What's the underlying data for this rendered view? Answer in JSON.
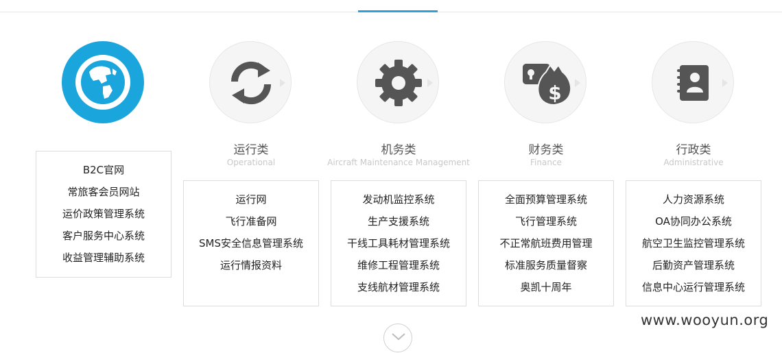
{
  "categories": [
    {
      "icon": "globe-icon",
      "items": [
        "B2C官网",
        "常旅客会员网站",
        "运价政策管理系统",
        "客户服务中心系统",
        "收益管理辅助系统"
      ]
    },
    {
      "icon": "refresh-icon",
      "title": "运行类",
      "subtitle": "Operational",
      "items": [
        "运行网",
        "飞行准备网",
        "SMS安全信息管理系统",
        "运行情报资料"
      ]
    },
    {
      "icon": "gear-icon",
      "title": "机务类",
      "subtitle": "Aircraft Maintenance Management",
      "items": [
        "发动机监控系统",
        "生产支援系统",
        "干线工具耗材管理系统",
        "维修工程管理系统",
        "支线航材管理系统"
      ]
    },
    {
      "icon": "money-bag-icon",
      "title": "财务类",
      "subtitle": "Finance",
      "items": [
        "全面预算管理系统",
        "飞行管理系统",
        "不正常航班费用管理",
        "标准服务质量督察",
        "奥凯十周年"
      ]
    },
    {
      "icon": "address-book-icon",
      "title": "行政类",
      "subtitle": "Administrative",
      "items": [
        "人力资源系统",
        "OA协同办公系统",
        "航空卫生监控管理系统",
        "后勤资产管理系统",
        "信息中心运行管理系统"
      ]
    }
  ],
  "watermark": "www.wooyun.org",
  "scroll_button_icon": "chevron-down-icon",
  "colors": {
    "accent": "#1aa6dc",
    "tab_indicator": "#2a9fd8",
    "icon_gray": "#555555"
  }
}
